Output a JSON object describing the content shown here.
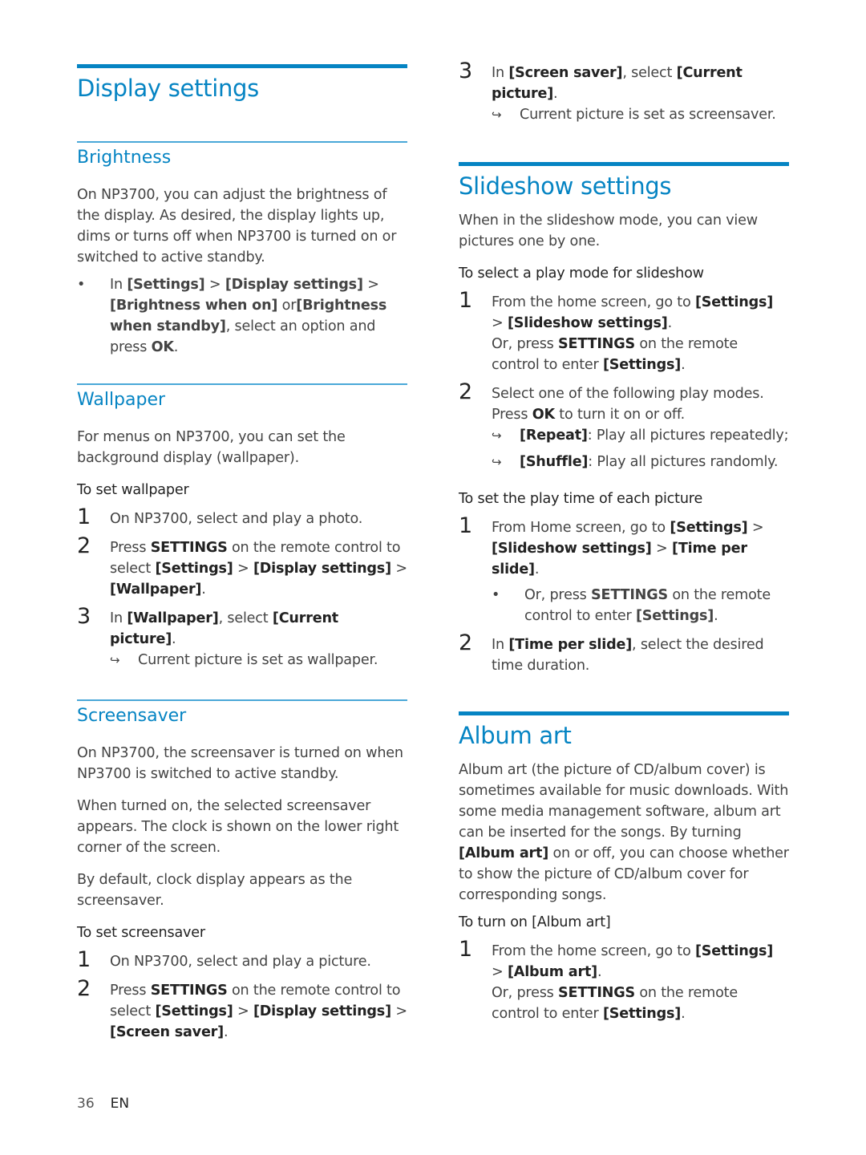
{
  "display_settings": {
    "title": "Display settings",
    "brightness": {
      "title": "Brightness",
      "intro": "On NP3700, you can adjust the brightness of the display. As desired, the display lights up, dims or turns off when NP3700 is turned on or switched to active standby.",
      "bullet": [
        {
          "t": "In "
        },
        {
          "t": "[Settings]",
          "b": true
        },
        {
          "t": " > "
        },
        {
          "t": "[Display settings]",
          "b": true
        },
        {
          "t": " > "
        },
        {
          "t": "[Brightness when on]",
          "b": true
        },
        {
          "t": " or"
        },
        {
          "t": "[Brightness when standby]",
          "b": true
        },
        {
          "t": ", select an option and press "
        },
        {
          "t": "OK",
          "b": true
        },
        {
          "t": "."
        }
      ]
    },
    "wallpaper": {
      "title": "Wallpaper",
      "intro": "For menus on NP3700, you can set the background display (wallpaper).",
      "subheading": "To set wallpaper",
      "steps": [
        {
          "num": "1",
          "runs": [
            {
              "t": "On NP3700, select and play a photo."
            }
          ]
        },
        {
          "num": "2",
          "runs": [
            {
              "t": "Press "
            },
            {
              "t": "SETTINGS",
              "b": true
            },
            {
              "t": " on the remote control to select "
            },
            {
              "t": "[Settings]",
              "b": true
            },
            {
              "t": " > "
            },
            {
              "t": "[Display settings]",
              "b": true
            },
            {
              "t": " > "
            },
            {
              "t": "[Wallpaper]",
              "b": true
            },
            {
              "t": "."
            }
          ]
        },
        {
          "num": "3",
          "runs": [
            {
              "t": "In "
            },
            {
              "t": "[Wallpaper]",
              "b": true
            },
            {
              "t": ", select "
            },
            {
              "t": "[Current picture]",
              "b": true
            },
            {
              "t": "."
            }
          ],
          "result": [
            {
              "t": "Current picture is set as wallpaper."
            }
          ]
        }
      ]
    },
    "screensaver": {
      "title": "Screensaver",
      "paragraphs": [
        "On NP3700, the screensaver is turned on when NP3700 is switched to active standby.",
        "When turned on, the selected screensaver appears. The clock is shown on the lower right corner of the screen.",
        "By default, clock display appears as the screensaver."
      ],
      "subheading": "To set screensaver",
      "steps": [
        {
          "num": "1",
          "runs": [
            {
              "t": "On NP3700, select and play a picture."
            }
          ]
        },
        {
          "num": "2",
          "runs": [
            {
              "t": "Press "
            },
            {
              "t": "SETTINGS",
              "b": true
            },
            {
              "t": " on the remote control to select "
            },
            {
              "t": "[Settings]",
              "b": true
            },
            {
              "t": " > "
            },
            {
              "t": "[Display settings]",
              "b": true
            },
            {
              "t": " > "
            },
            {
              "t": "[Screen saver]",
              "b": true
            },
            {
              "t": "."
            }
          ]
        },
        {
          "num": "3",
          "runs": [
            {
              "t": "In "
            },
            {
              "t": "[Screen saver]",
              "b": true
            },
            {
              "t": ", select "
            },
            {
              "t": "[Current picture]",
              "b": true
            },
            {
              "t": "."
            }
          ],
          "result": [
            {
              "t": "Current picture is set as screensaver."
            }
          ]
        }
      ]
    }
  },
  "slideshow_settings": {
    "title": "Slideshow settings",
    "intro": "When in the slideshow mode, you can view pictures one by one.",
    "play_mode": {
      "subheading": "To select a play mode for slideshow",
      "steps": [
        {
          "num": "1",
          "runs": [
            {
              "t": "From the home screen, go to "
            },
            {
              "t": "[Settings]",
              "b": true
            },
            {
              "t": " > "
            },
            {
              "t": "[Slideshow settings]",
              "b": true
            },
            {
              "t": "."
            }
          ],
          "extra": [
            {
              "t": "Or, press "
            },
            {
              "t": "SETTINGS",
              "b": true
            },
            {
              "t": " on the remote control to enter "
            },
            {
              "t": "[Settings]",
              "b": true
            },
            {
              "t": "."
            }
          ]
        },
        {
          "num": "2",
          "runs": [
            {
              "t": "Select one of the following play modes. Press "
            },
            {
              "t": "OK",
              "b": true
            },
            {
              "t": " to turn it on or off."
            }
          ],
          "results": [
            [
              {
                "t": "[Repeat]",
                "b": true
              },
              {
                "t": ": Play all pictures repeatedly;"
              }
            ],
            [
              {
                "t": "[Shuffle]",
                "b": true
              },
              {
                "t": ": Play all pictures randomly."
              }
            ]
          ]
        }
      ]
    },
    "play_time": {
      "subheading": "To set the play time of each picture",
      "steps": [
        {
          "num": "1",
          "runs": [
            {
              "t": "From Home screen, go to "
            },
            {
              "t": "[Settings]",
              "b": true
            },
            {
              "t": " > "
            },
            {
              "t": "[Slideshow settings]",
              "b": true
            },
            {
              "t": " > "
            },
            {
              "t": "[Time per slide]",
              "b": true
            },
            {
              "t": "."
            }
          ],
          "bullet": [
            {
              "t": "Or, press "
            },
            {
              "t": "SETTINGS",
              "b": true
            },
            {
              "t": " on the remote control to enter "
            },
            {
              "t": "[Settings]",
              "b": true
            },
            {
              "t": "."
            }
          ]
        },
        {
          "num": "2",
          "runs": [
            {
              "t": "In "
            },
            {
              "t": "[Time per slide]",
              "b": true
            },
            {
              "t": ", select the desired time duration."
            }
          ]
        }
      ]
    }
  },
  "album_art": {
    "title": "Album art",
    "intro": [
      {
        "t": "Album art (the picture of CD/album cover) is sometimes available for music downloads. With some media management software, album art can be inserted for the songs. By turning "
      },
      {
        "t": "[Album art]",
        "b": true
      },
      {
        "t": " on or off, you can choose whether to show the picture of CD/album cover for corresponding songs."
      }
    ],
    "subheading": "To turn on [Album art]",
    "steps": [
      {
        "num": "1",
        "runs": [
          {
            "t": "From the home screen, go to "
          },
          {
            "t": "[Settings]",
            "b": true
          },
          {
            "t": " > "
          },
          {
            "t": "[Album art]",
            "b": true
          },
          {
            "t": "."
          }
        ],
        "extra": [
          {
            "t": "Or, press "
          },
          {
            "t": "SETTINGS",
            "b": true
          },
          {
            "t": " on the remote control to enter "
          },
          {
            "t": "[Settings]",
            "b": true
          },
          {
            "t": "."
          }
        ]
      }
    ]
  },
  "footer": {
    "page_number": "36",
    "language": "EN"
  },
  "icons": {
    "result_arrow": "↪",
    "bullet": "•"
  },
  "colors": {
    "heading_blue": "#0584c3",
    "body_text": "#444444"
  }
}
